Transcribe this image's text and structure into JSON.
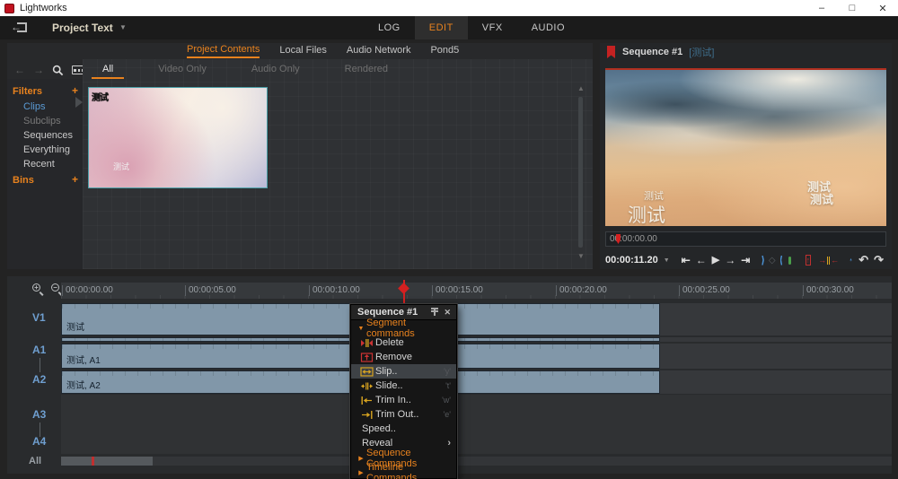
{
  "window": {
    "title": "Lightworks",
    "controls": {
      "minimize": "–",
      "maximize": "□",
      "close": "✕"
    }
  },
  "topbar": {
    "project_name": "Project Text",
    "dropdown_icon": "▼",
    "tabs": [
      {
        "label": "LOG",
        "active": false
      },
      {
        "label": "EDIT",
        "active": true
      },
      {
        "label": "VFX",
        "active": false
      },
      {
        "label": "AUDIO",
        "active": false
      }
    ]
  },
  "browser": {
    "tabs": [
      {
        "label": "Project Contents",
        "active": true
      },
      {
        "label": "Local Files",
        "active": false
      },
      {
        "label": "Audio Network",
        "active": false
      },
      {
        "label": "Pond5",
        "active": false
      }
    ],
    "nav": {
      "back": "←",
      "forward": "→"
    },
    "filters_title": "Filters",
    "filters_add": "+",
    "filter_items": [
      {
        "label": "Clips",
        "state": "selected"
      },
      {
        "label": "Subclips",
        "state": "dim"
      },
      {
        "label": "Sequences",
        "state": "normal"
      },
      {
        "label": "Everything",
        "state": "normal"
      },
      {
        "label": "Recent",
        "state": "normal"
      }
    ],
    "bins_title": "Bins",
    "bins_add": "+",
    "subtabs": [
      {
        "label": "All",
        "active": true
      },
      {
        "label": "Video Only",
        "active": false
      },
      {
        "label": "Audio Only",
        "active": false
      },
      {
        "label": "Rendered",
        "active": false
      }
    ],
    "clip": {
      "corner_label": "测试",
      "overlay_label": "测试"
    },
    "scroll_up": "▲",
    "scroll_down": "▼"
  },
  "viewer": {
    "title": "Sequence #1",
    "subtitle": "[测试]",
    "overlay_small_left": "测试",
    "overlay_large_left": "测试",
    "overlay_right_1": "测试",
    "overlay_right_2": "测试",
    "scrub_timecode": "00:00:00.00",
    "timecode": "00:00:11.20",
    "timecode_dropdown": "▼",
    "transport": {
      "go_start": "⇤",
      "step_back": "←",
      "play": "▶",
      "step_fwd": "→",
      "go_end": "⇥",
      "diamond": "◇",
      "insert_arrow": "↑",
      "replace_left": "→",
      "replace_right": "←",
      "undo": "↶",
      "redo": "↷"
    }
  },
  "timeline": {
    "ruler_labels": [
      "00:00:00.00",
      "00:00:05.00",
      "00:00:10.00",
      "00:00:15.00",
      "00:00:20.00",
      "00:00:25.00",
      "00:00:30.00"
    ],
    "zoom_in": "+",
    "zoom_out": "−",
    "tracks": [
      {
        "label": "V1",
        "clip_label": "测试"
      },
      {
        "label": "A1",
        "clip_label": "测试, A1"
      },
      {
        "label": "A2",
        "clip_label": "测试, A2"
      },
      {
        "label": "A3",
        "clip_label": ""
      },
      {
        "label": "A4",
        "clip_label": ""
      }
    ],
    "all_label": "All"
  },
  "context_menu": {
    "title": "Sequence #1",
    "close_icon": "✕",
    "open_marker": "▼",
    "closed_marker": "▶",
    "submenu_arrow": "›",
    "sections": {
      "segment": "Segment commands",
      "sequence": "Sequence Commands",
      "timeline": "Timeline Commands"
    },
    "items": [
      {
        "label": "Delete",
        "shortcut": ""
      },
      {
        "label": "Remove",
        "shortcut": ""
      },
      {
        "label": "Slip..",
        "shortcut": "'y'",
        "highlighted": true
      },
      {
        "label": "Slide..",
        "shortcut": "'t'"
      },
      {
        "label": "Trim In..",
        "shortcut": "'w'"
      },
      {
        "label": "Trim Out..",
        "shortcut": "'e'"
      },
      {
        "label": "Speed..",
        "shortcut": ""
      },
      {
        "label": "Reveal",
        "shortcut": ""
      }
    ]
  },
  "colors": {
    "accent_orange": "#e8821e",
    "selection_blue": "#5b9bd5",
    "clip_fill": "#8197a9",
    "alert_red": "#c42222",
    "marker_green": "#4a9e4a",
    "playhead_red": "#d42020"
  }
}
